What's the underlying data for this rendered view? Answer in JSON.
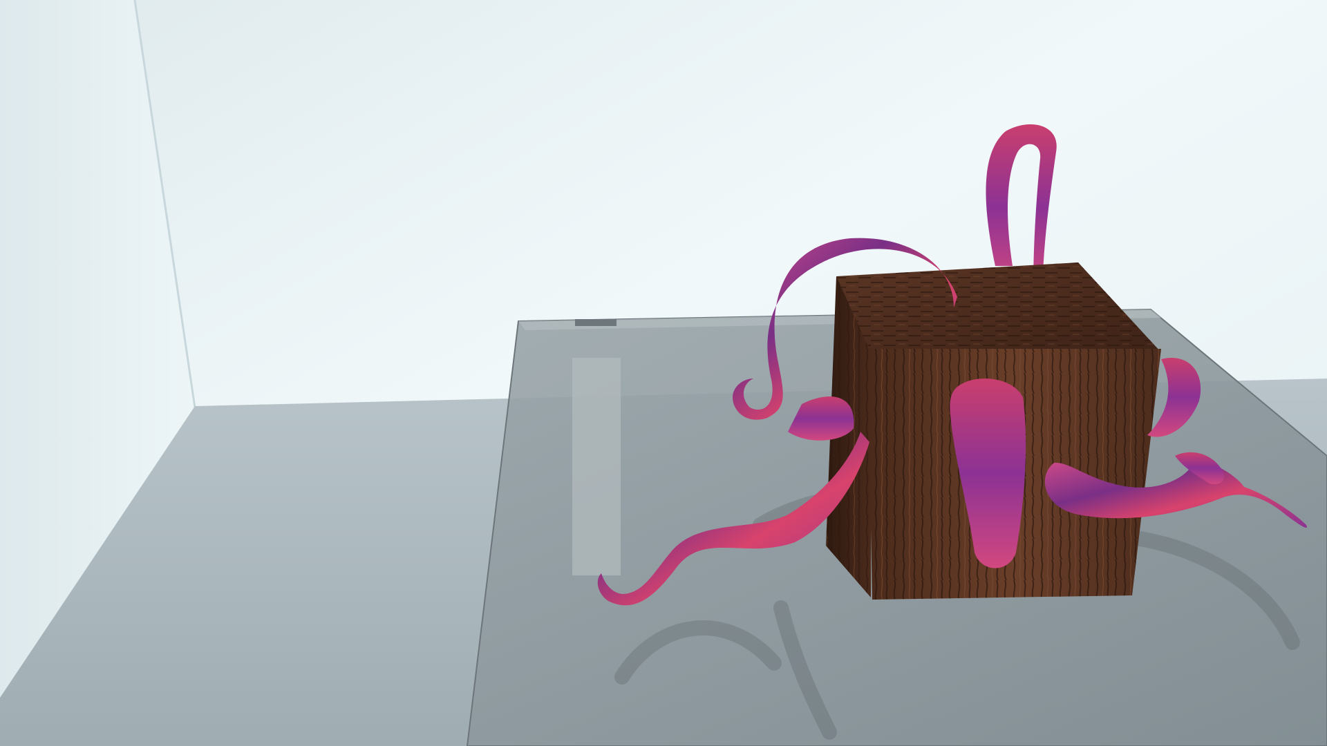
{
  "scene": {
    "kind": "3d-render",
    "subject": "wooden-cube-with-tentacles",
    "colors": {
      "wall": "#eef6f8",
      "wall_shadow": "#cfdfe4",
      "floor": "#aab7bd",
      "glass": "#8f9a9f",
      "wood_dark": "#3b2216",
      "wood_mid": "#5a3624",
      "wood_light": "#7a4a31",
      "tentacle_pink": "#c2417f",
      "tentacle_purple": "#6b2d7d",
      "tentacle_red": "#e0476a"
    }
  }
}
